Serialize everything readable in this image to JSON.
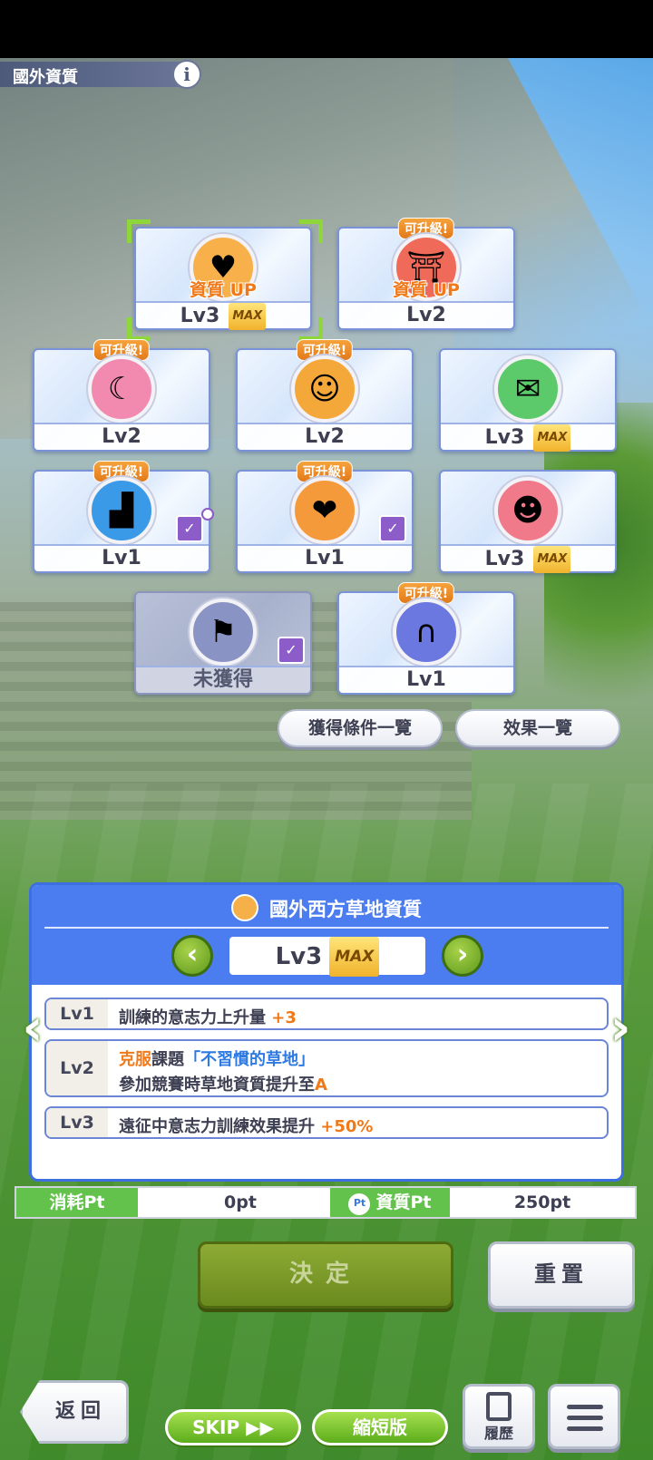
{
  "header": {
    "title": "國外資質",
    "info_label": "i"
  },
  "cards": [
    {
      "level": "Lv3",
      "max": "MAX",
      "up_text": "資質 UP",
      "upgrade": "",
      "icon": "sun-heart-icon",
      "color": "#f7b04a",
      "selected": true
    },
    {
      "level": "Lv2",
      "max": "",
      "up_text": "資質 UP",
      "upgrade": "可升級!",
      "icon": "gate-icon",
      "color": "#f06a5a"
    },
    {
      "level": "Lv2",
      "max": "",
      "up_text": "",
      "upgrade": "可升級!",
      "icon": "sun-moon-icon",
      "color": "#f28ab0"
    },
    {
      "level": "Lv2",
      "max": "",
      "up_text": "",
      "upgrade": "可升級!",
      "icon": "horse-fork-icon",
      "color": "#f5a83a"
    },
    {
      "level": "Lv3",
      "max": "MAX",
      "up_text": "",
      "upgrade": "",
      "icon": "horse-chat-icon",
      "color": "#5cc96a"
    },
    {
      "level": "Lv1",
      "max": "",
      "up_text": "",
      "upgrade": "可升級!",
      "icon": "stairs-icon",
      "color": "#3a9ae8"
    },
    {
      "level": "Lv1",
      "max": "",
      "up_text": "",
      "upgrade": "可升級!",
      "icon": "horse-heart-icon",
      "color": "#f59a3a"
    },
    {
      "level": "Lv3",
      "max": "MAX",
      "up_text": "",
      "upgrade": "",
      "icon": "devil-horse-icon",
      "color": "#f07a8a"
    },
    {
      "level": "未獲得",
      "max": "",
      "up_text": "",
      "upgrade": "",
      "icon": "flag-icon",
      "color": "#8a94c4",
      "locked": true
    },
    {
      "level": "Lv1",
      "max": "",
      "up_text": "",
      "upgrade": "可升級!",
      "icon": "arc-de-triomphe-icon",
      "color": "#6a78e0"
    }
  ],
  "buttons": {
    "conditions": "獲得條件一覽",
    "effects": "效果一覽",
    "decide": "決定",
    "reset": "重置",
    "back": "返回",
    "skip": "SKIP ▶▶",
    "short": "縮短版",
    "history": "履歷"
  },
  "detail": {
    "title": "國外西方草地資質",
    "level": "Lv3",
    "max": "MAX",
    "rows": [
      {
        "label": "Lv1",
        "text": "訓練的意志力上升量",
        "bonus": "+3"
      },
      {
        "label": "Lv2",
        "line1_a": "克服",
        "line1_b": "課題",
        "line1_c": "「不習慣的草地」",
        "line2_a": "參加競賽時草地資質提升至",
        "line2_b": "A"
      },
      {
        "label": "Lv3",
        "text": "遠征中意志力訓練效果提升",
        "bonus": "+50%"
      }
    ]
  },
  "points": {
    "cost_label": "消耗Pt",
    "cost_value": "0pt",
    "stat_label": "資質Pt",
    "stat_icon": "Pt",
    "stat_value": "250pt"
  },
  "colors": {
    "panel": "#4b7df0",
    "accent_green": "#62c24c",
    "upgrade": "#f28a2a"
  }
}
